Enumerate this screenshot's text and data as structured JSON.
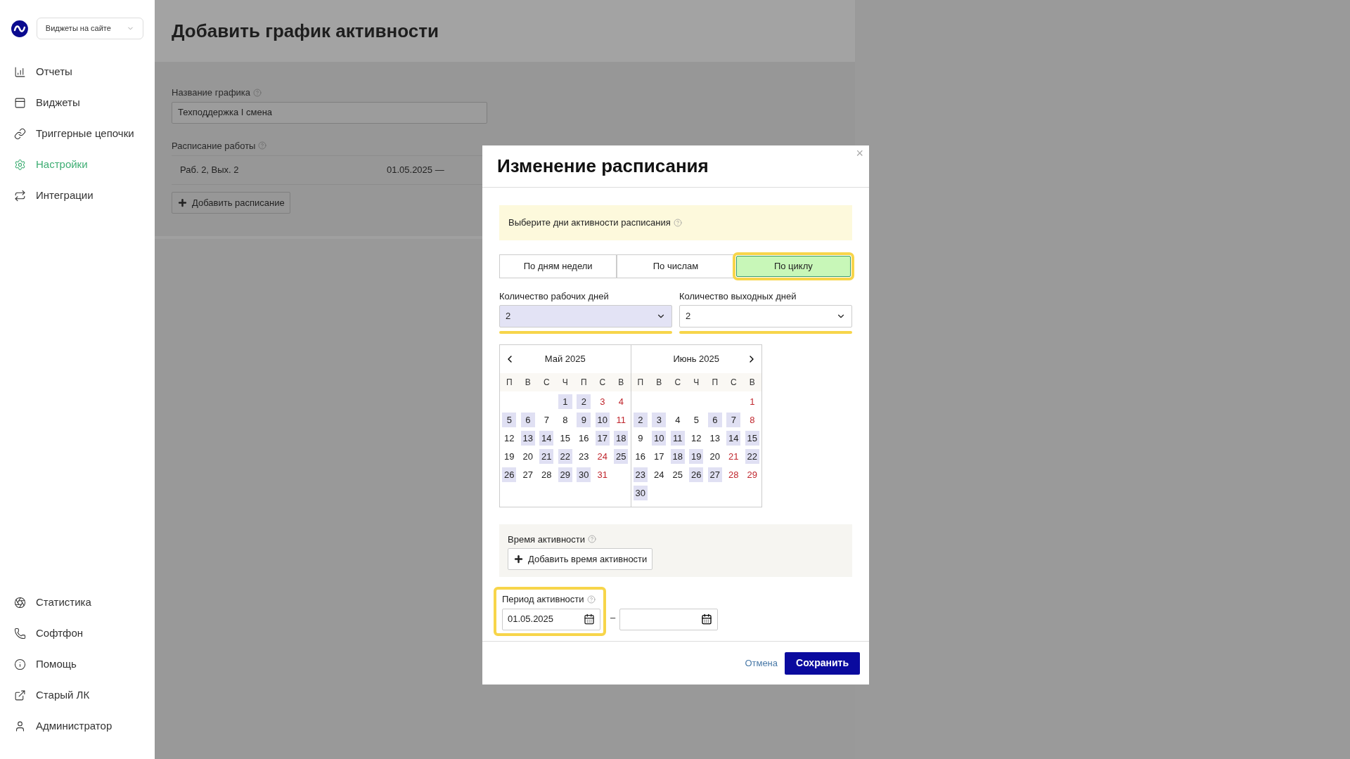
{
  "sidebar": {
    "site_select": {
      "value": "Виджеты на сайте"
    },
    "items": [
      {
        "label": "Отчеты",
        "selected": false
      },
      {
        "label": "Виджеты",
        "selected": false
      },
      {
        "label": "Триггерные цепочки",
        "selected": false
      },
      {
        "label": "Настройки",
        "selected": true
      },
      {
        "label": "Интеграции",
        "selected": false
      }
    ],
    "bottom_items": [
      {
        "label": "Статистика",
        "selected": false
      },
      {
        "label": "Софтфон",
        "selected": false
      },
      {
        "label": "Помощь",
        "selected": false
      },
      {
        "label": "Старый ЛК",
        "selected": false
      },
      {
        "label": "Администратор",
        "selected": false
      }
    ]
  },
  "page": {
    "title": "Добавить график активности",
    "name_label": "Название графика",
    "name_value": "Техподдержка I смена",
    "schedule_label": "Расписание работы",
    "schedules": [
      {
        "summary": "Раб. 2, Вых. 2",
        "period": "01.05.2025 —"
      }
    ],
    "add_schedule": "Добавить расписание"
  },
  "modal": {
    "title": "Изменение расписания",
    "close": "×",
    "notice": "Выберите дни активности расписания",
    "tabs": [
      {
        "label": "По дням недели",
        "selected": false,
        "highlighted": false
      },
      {
        "label": "По числам",
        "selected": false,
        "highlighted": false
      },
      {
        "label": "По циклу",
        "selected": true,
        "highlighted": true
      }
    ],
    "selects": [
      {
        "label": "Количество рабочих дней",
        "value": "2",
        "focused": true,
        "highlighted": true
      },
      {
        "label": "Количество выходных дней",
        "value": "2",
        "focused": false,
        "highlighted": true
      }
    ],
    "calendar": {
      "months": [
        {
          "title": "Май 2025",
          "weekdays": [
            "П",
            "В",
            "С",
            "Ч",
            "П",
            "С",
            "В"
          ],
          "weeks": [
            [
              {
                "kind": "blank"
              },
              {
                "kind": "blank"
              },
              {
                "kind": "blank"
              },
              {
                "kind": "day",
                "d": "1",
                "work": true,
                "red": false
              },
              {
                "kind": "day",
                "d": "2",
                "work": true,
                "red": false
              },
              {
                "kind": "day",
                "d": "3",
                "work": false,
                "red": true
              },
              {
                "kind": "day",
                "d": "4",
                "work": false,
                "red": true
              }
            ],
            [
              {
                "kind": "day",
                "d": "5",
                "work": true,
                "red": false
              },
              {
                "kind": "day",
                "d": "6",
                "work": true,
                "red": false
              },
              {
                "kind": "day",
                "d": "7",
                "work": false,
                "red": false
              },
              {
                "kind": "day",
                "d": "8",
                "work": false,
                "red": false
              },
              {
                "kind": "day",
                "d": "9",
                "work": true,
                "red": false
              },
              {
                "kind": "day",
                "d": "10",
                "work": true,
                "red": false
              },
              {
                "kind": "day",
                "d": "11",
                "work": false,
                "red": true
              }
            ],
            [
              {
                "kind": "day",
                "d": "12",
                "work": false,
                "red": false
              },
              {
                "kind": "day",
                "d": "13",
                "work": true,
                "red": false
              },
              {
                "kind": "day",
                "d": "14",
                "work": true,
                "red": false
              },
              {
                "kind": "day",
                "d": "15",
                "work": false,
                "red": false
              },
              {
                "kind": "day",
                "d": "16",
                "work": false,
                "red": false
              },
              {
                "kind": "day",
                "d": "17",
                "work": true,
                "red": false
              },
              {
                "kind": "day",
                "d": "18",
                "work": true,
                "red": false
              }
            ],
            [
              {
                "kind": "day",
                "d": "19",
                "work": false,
                "red": false
              },
              {
                "kind": "day",
                "d": "20",
                "work": false,
                "red": false
              },
              {
                "kind": "day",
                "d": "21",
                "work": true,
                "red": false
              },
              {
                "kind": "day",
                "d": "22",
                "work": true,
                "red": false
              },
              {
                "kind": "day",
                "d": "23",
                "work": false,
                "red": false
              },
              {
                "kind": "day",
                "d": "24",
                "work": false,
                "red": true
              },
              {
                "kind": "day",
                "d": "25",
                "work": true,
                "red": false
              }
            ],
            [
              {
                "kind": "day",
                "d": "26",
                "work": true,
                "red": false
              },
              {
                "kind": "day",
                "d": "27",
                "work": false,
                "red": false
              },
              {
                "kind": "day",
                "d": "28",
                "work": false,
                "red": false
              },
              {
                "kind": "day",
                "d": "29",
                "work": true,
                "red": false
              },
              {
                "kind": "day",
                "d": "30",
                "work": true,
                "red": false
              },
              {
                "kind": "day",
                "d": "31",
                "work": false,
                "red": true
              }
            ]
          ]
        },
        {
          "title": "Июнь 2025",
          "weekdays": [
            "П",
            "В",
            "С",
            "Ч",
            "П",
            "С",
            "В"
          ],
          "weeks": [
            [
              {
                "kind": "blank"
              },
              {
                "kind": "blank"
              },
              {
                "kind": "blank"
              },
              {
                "kind": "blank"
              },
              {
                "kind": "blank"
              },
              {
                "kind": "blank"
              },
              {
                "kind": "day",
                "d": "1",
                "work": false,
                "red": true
              }
            ],
            [
              {
                "kind": "day",
                "d": "2",
                "work": true,
                "red": false
              },
              {
                "kind": "day",
                "d": "3",
                "work": true,
                "red": false
              },
              {
                "kind": "day",
                "d": "4",
                "work": false,
                "red": false
              },
              {
                "kind": "day",
                "d": "5",
                "work": false,
                "red": false
              },
              {
                "kind": "day",
                "d": "6",
                "work": true,
                "red": false
              },
              {
                "kind": "day",
                "d": "7",
                "work": true,
                "red": false
              },
              {
                "kind": "day",
                "d": "8",
                "work": false,
                "red": true
              }
            ],
            [
              {
                "kind": "day",
                "d": "9",
                "work": false,
                "red": false
              },
              {
                "kind": "day",
                "d": "10",
                "work": true,
                "red": false
              },
              {
                "kind": "day",
                "d": "11",
                "work": true,
                "red": false
              },
              {
                "kind": "day",
                "d": "12",
                "work": false,
                "red": false
              },
              {
                "kind": "day",
                "d": "13",
                "work": false,
                "red": false
              },
              {
                "kind": "day",
                "d": "14",
                "work": true,
                "red": false
              },
              {
                "kind": "day",
                "d": "15",
                "work": true,
                "red": false
              }
            ],
            [
              {
                "kind": "day",
                "d": "16",
                "work": false,
                "red": false
              },
              {
                "kind": "day",
                "d": "17",
                "work": false,
                "red": false
              },
              {
                "kind": "day",
                "d": "18",
                "work": true,
                "red": false
              },
              {
                "kind": "day",
                "d": "19",
                "work": true,
                "red": false
              },
              {
                "kind": "day",
                "d": "20",
                "work": false,
                "red": false
              },
              {
                "kind": "day",
                "d": "21",
                "work": false,
                "red": true
              },
              {
                "kind": "day",
                "d": "22",
                "work": true,
                "red": false
              }
            ],
            [
              {
                "kind": "day",
                "d": "23",
                "work": true,
                "red": false
              },
              {
                "kind": "day",
                "d": "24",
                "work": false,
                "red": false
              },
              {
                "kind": "day",
                "d": "25",
                "work": false,
                "red": false
              },
              {
                "kind": "day",
                "d": "26",
                "work": true,
                "red": false
              },
              {
                "kind": "day",
                "d": "27",
                "work": true,
                "red": false
              },
              {
                "kind": "day",
                "d": "28",
                "work": false,
                "red": true
              },
              {
                "kind": "day",
                "d": "29",
                "work": false,
                "red": true
              }
            ],
            [
              {
                "kind": "day",
                "d": "30",
                "work": true,
                "red": false
              }
            ]
          ]
        }
      ]
    },
    "activity_time": {
      "label": "Время активности",
      "button": "Добавить время активности"
    },
    "period": {
      "label": "Период активности",
      "highlighted": true,
      "from": {
        "value": "01.05.2025"
      },
      "dash": "–"
    },
    "cancel": "Отмена",
    "save": "Сохранить"
  }
}
